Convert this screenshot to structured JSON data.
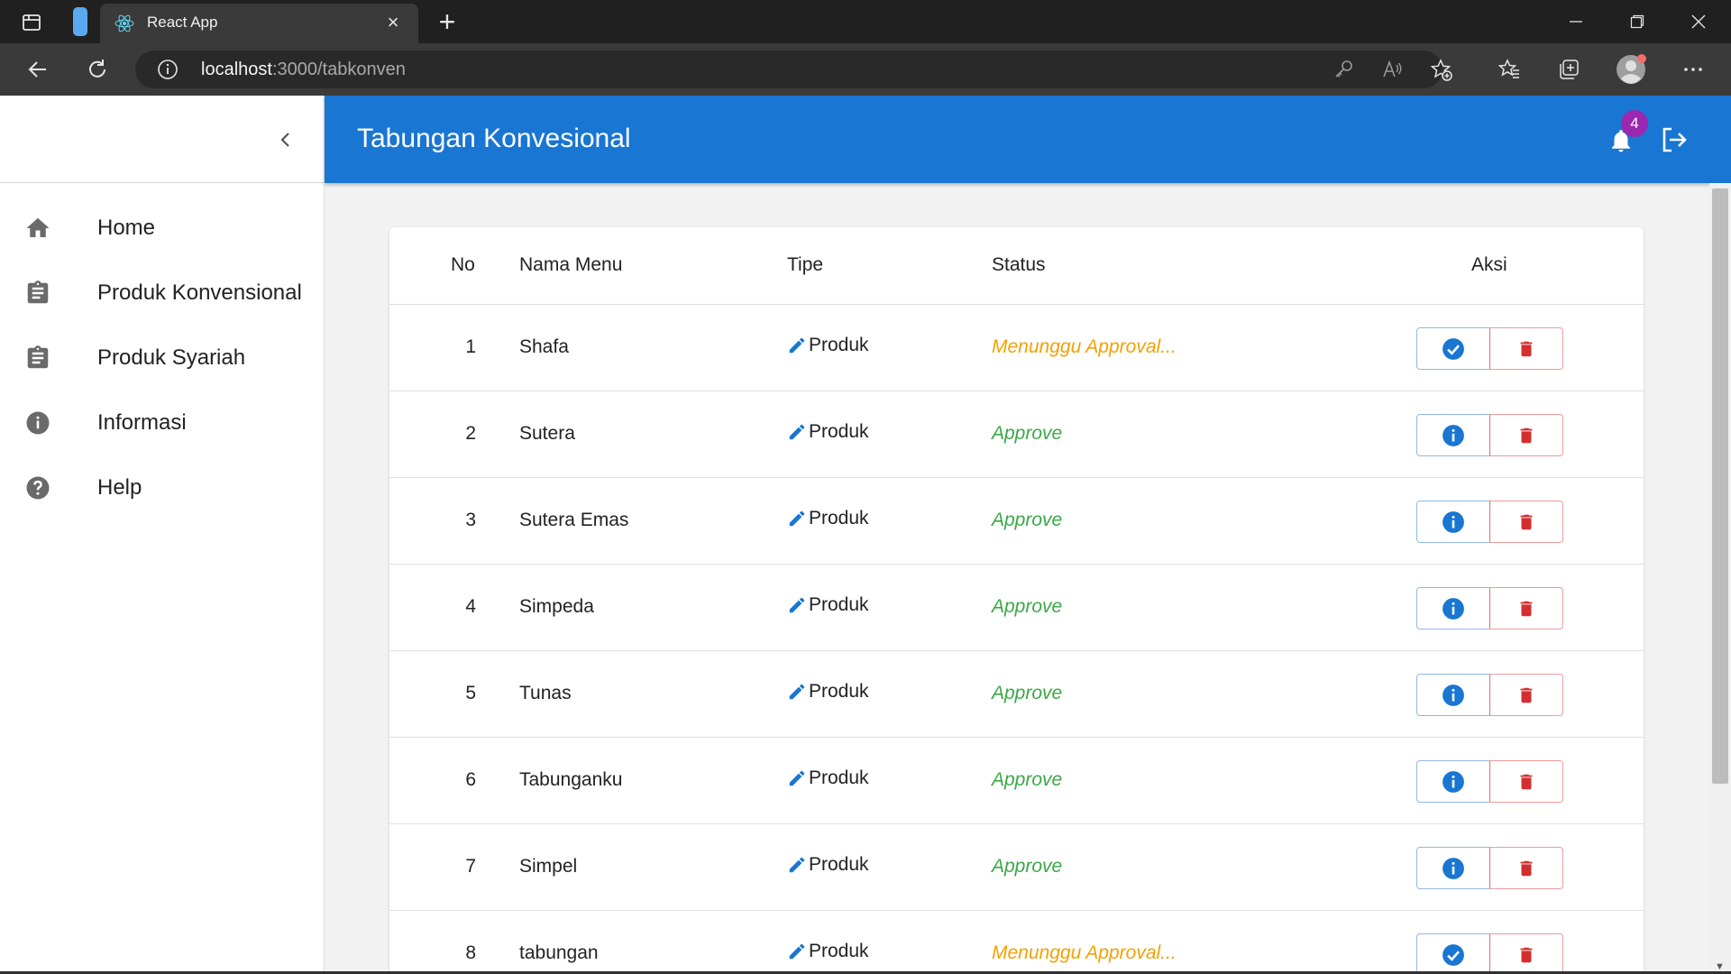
{
  "browser": {
    "tab_title": "React App",
    "new_tab_symbol": "+",
    "url_host": "localhost",
    "url_rest": ":3000/tabkonven"
  },
  "sidebar": {
    "items": [
      {
        "label": "Home",
        "icon": "home-icon"
      },
      {
        "label": "Produk Konvensional",
        "icon": "clipboard-icon"
      },
      {
        "label": "Produk Syariah",
        "icon": "clipboard-icon"
      },
      {
        "label": "Informasi",
        "icon": "info-icon"
      },
      {
        "label": "Help",
        "icon": "help-icon"
      }
    ]
  },
  "appbar": {
    "title": "Tabungan Konvesional",
    "notification_count": "4"
  },
  "table": {
    "headers": {
      "no": "No",
      "name": "Nama Menu",
      "tipe": "Tipe",
      "status": "Status",
      "aksi": "Aksi"
    },
    "rows": [
      {
        "no": "1",
        "name": "Shafa",
        "tipe": "Produk",
        "status": "Menunggu Approval...",
        "state": "pending"
      },
      {
        "no": "2",
        "name": "Sutera",
        "tipe": "Produk",
        "status": "Approve",
        "state": "approve"
      },
      {
        "no": "3",
        "name": "Sutera Emas",
        "tipe": "Produk",
        "status": "Approve",
        "state": "approve"
      },
      {
        "no": "4",
        "name": "Simpeda",
        "tipe": "Produk",
        "status": "Approve",
        "state": "approve"
      },
      {
        "no": "5",
        "name": "Tunas",
        "tipe": "Produk",
        "status": "Approve",
        "state": "approve"
      },
      {
        "no": "6",
        "name": "Tabunganku",
        "tipe": "Produk",
        "status": "Approve",
        "state": "approve"
      },
      {
        "no": "7",
        "name": "Simpel",
        "tipe": "Produk",
        "status": "Approve",
        "state": "approve"
      },
      {
        "no": "8",
        "name": "tabungan",
        "tipe": "Produk",
        "status": "Menunggu Approval...",
        "state": "pending"
      }
    ]
  },
  "colors": {
    "appbar": "#1976d2",
    "pending": "#f5a000",
    "approve": "#3aa846",
    "danger": "#d32f2f",
    "badge": "#9c27b0"
  }
}
